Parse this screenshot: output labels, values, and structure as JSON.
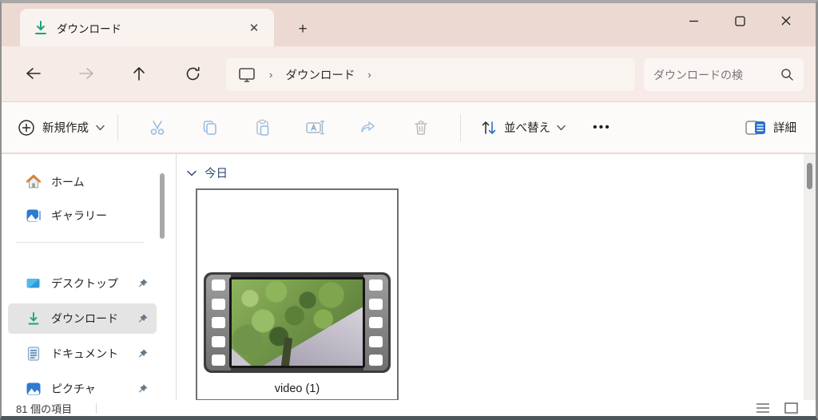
{
  "window": {
    "controls": {
      "minimize": "–",
      "maximize": "",
      "close": "✕"
    }
  },
  "tab": {
    "title": "ダウンロード",
    "close_glyph": "✕",
    "new_tab_glyph": "+"
  },
  "nav": {
    "breadcrumb": {
      "root_icon": "this-pc-monitor-icon",
      "separator": "›",
      "items": [
        {
          "label": "ダウンロード"
        }
      ]
    },
    "search": {
      "placeholder": "ダウンロードの検"
    }
  },
  "toolbar": {
    "new_label": "新規作成",
    "sort_label": "並べ替え",
    "more_glyph": "•••",
    "details_label": "詳細"
  },
  "sidebar": {
    "items": [
      {
        "label": "ホーム",
        "icon": "home-icon",
        "pinned": false,
        "selected": false
      },
      {
        "label": "ギャラリー",
        "icon": "gallery-icon",
        "pinned": false,
        "selected": false
      },
      {
        "label": "デスクトップ",
        "icon": "desktop-icon",
        "pinned": true,
        "selected": false
      },
      {
        "label": "ダウンロード",
        "icon": "download-icon",
        "pinned": true,
        "selected": true
      },
      {
        "label": "ドキュメント",
        "icon": "document-icon",
        "pinned": true,
        "selected": false
      },
      {
        "label": "ピクチャ",
        "icon": "pictures-icon",
        "pinned": true,
        "selected": false
      }
    ]
  },
  "content": {
    "group_header": "今日",
    "items": [
      {
        "name": "video (1)",
        "type": "video-thumbnail"
      }
    ]
  },
  "statusbar": {
    "item_count": "81 個の項目"
  },
  "colors": {
    "titlebar_bg": "#ecd9d1",
    "tab_bg": "#f9f3ef",
    "navbar_bg": "#f6ebe6",
    "accent_blue": "#2970c8",
    "download_green": "#16a57f",
    "selection_gray": "#e4e4e4"
  }
}
